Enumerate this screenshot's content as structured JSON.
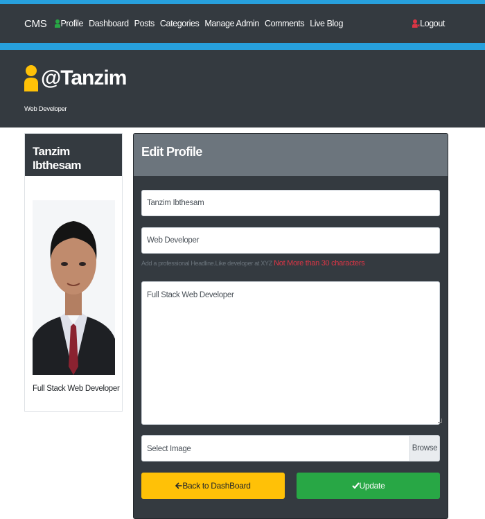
{
  "nav": {
    "brand": "CMS",
    "items": [
      "Profile",
      "Dashboard",
      "Posts",
      "Categories",
      "Manage Admin",
      "Comments",
      "Live Blog"
    ],
    "logout": "Logout"
  },
  "header": {
    "username": "@Tanzim",
    "headline": "Web Developer"
  },
  "profile_card": {
    "name": "Tanzim Ibthesam",
    "bio": "Full Stack Web Developer"
  },
  "edit_form": {
    "title": "Edit Profile",
    "name_value": "Tanzim Ibthesam",
    "headline_value": "Web Developer",
    "headline_hint": "Add a professional Headline.Like developer at XYZ",
    "headline_warning": "Not More than 30 characters",
    "bio_value": "Full Stack Web Developer",
    "image_label": "Select Image",
    "browse_label": "Browse",
    "back_button": "Back to DashBoard",
    "update_button": "Update"
  },
  "colors": {
    "accent_stripe": "#27a0dd",
    "dark": "#343a40",
    "card_header": "#6c757d",
    "warning": "#ffc107",
    "success": "#28a745",
    "danger": "#dc3545",
    "profile_icon": "#28a745",
    "logout_icon": "#dc3545",
    "header_icon": "#ffc107"
  }
}
